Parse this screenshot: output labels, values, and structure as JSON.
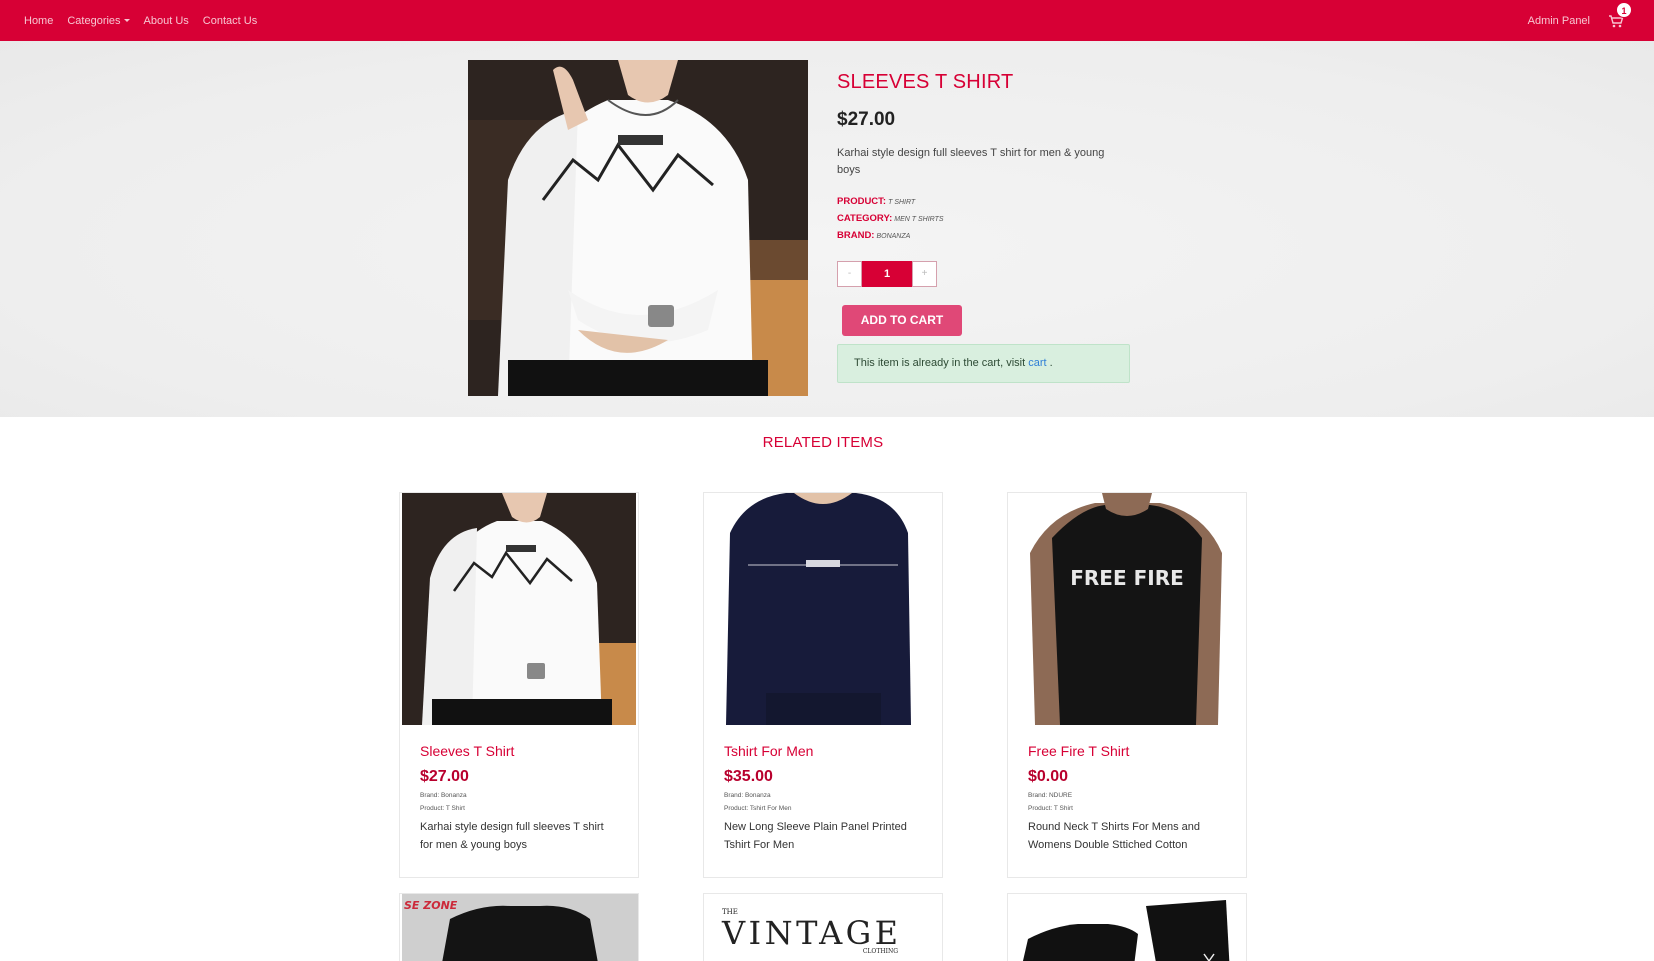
{
  "nav": {
    "links": [
      "Home",
      "Categories",
      "About Us",
      "Contact Us"
    ],
    "admin_label": "Admin Panel",
    "cart_count": "1",
    "brand_color": "#d70035"
  },
  "product": {
    "title": "SLEEVES T SHIRT",
    "price": "$27.00",
    "description": "Karhai style design full sleeves T shirt for men & young boys",
    "meta": [
      {
        "key": "PRODUCT:",
        "value": "T SHIRT"
      },
      {
        "key": "CATEGORY:",
        "value": "MEN T SHIRTS"
      },
      {
        "key": "BRAND:",
        "value": "BONANZA"
      }
    ],
    "qty_minus": "-",
    "qty_value": "1",
    "qty_plus": "+",
    "add_to_cart": "ADD TO CART",
    "alert_text": "This item is already in the cart, visit",
    "alert_link": "cart",
    "alert_end": "."
  },
  "related": {
    "title": "RELATED ITEMS",
    "items": [
      {
        "name": "Sleeves T Shirt",
        "price": "$27.00",
        "brand": "Brand: Bonanza",
        "product": "Product: T Shirt",
        "desc": "Karhai style design full sleeves T shirt for men & young boys"
      },
      {
        "name": "Tshirt For Men",
        "price": "$35.00",
        "brand": "Brand: Bonanza",
        "product": "Product: Tshirt For Men",
        "desc": "New Long Sleeve Plain Panel Printed Tshirt For Men"
      },
      {
        "name": "Free Fire T Shirt",
        "price": "$0.00",
        "brand": "Brand: NDURE",
        "product": "Product: T Shirt",
        "desc": "Round Neck T Shirts For Mens and Womens Double Sttiched Cotton"
      }
    ],
    "bottom_texts": {
      "zone": "SE ZONE",
      "vintage_the": "THE",
      "vintage": "VINTAGE",
      "vintage_sub": "CLOTHING",
      "freefire": "FREE FIRE"
    }
  }
}
